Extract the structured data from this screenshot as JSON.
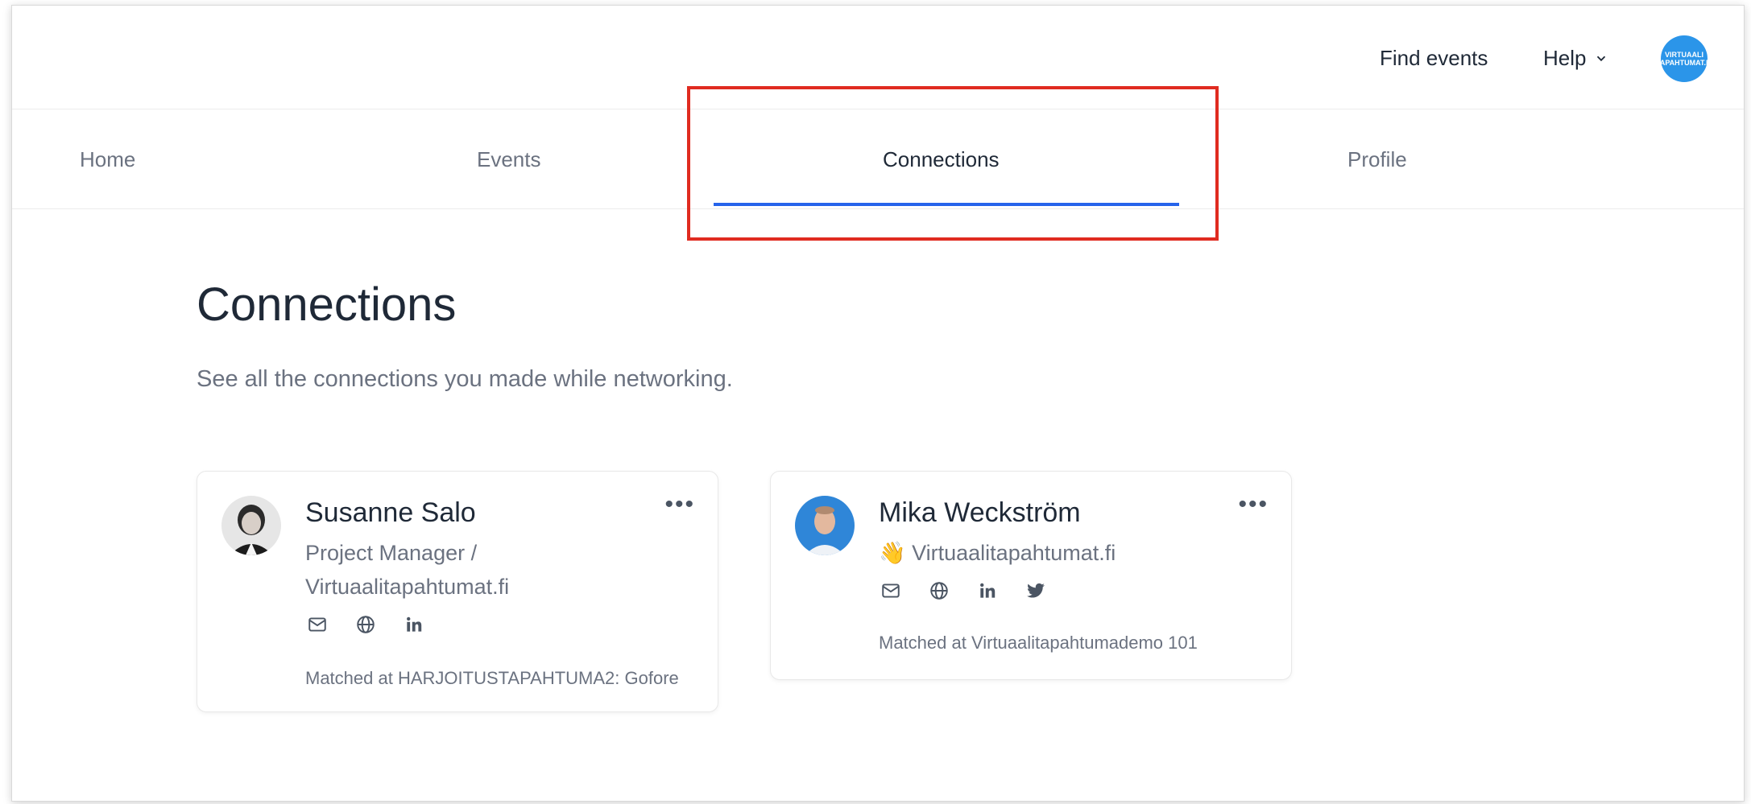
{
  "header": {
    "find_events": "Find events",
    "help": "Help",
    "avatar_text": "VIRTUAALI TAPAHTUMAT.FI"
  },
  "tabs": [
    {
      "label": "Home"
    },
    {
      "label": "Events"
    },
    {
      "label": "Connections",
      "active": true
    },
    {
      "label": "Profile"
    }
  ],
  "main": {
    "title": "Connections",
    "subtitle": "See all the connections you made while networking."
  },
  "connections": [
    {
      "name": "Susanne Salo",
      "title_line1": "Project Manager /",
      "title_line2": "Virtuaalitapahtumat.fi",
      "icons": [
        "mail-icon",
        "globe-icon",
        "linkedin-icon"
      ],
      "matched": "Matched at HARJOITUSTAPAHTUMA2: Gofore",
      "menu": "•••"
    },
    {
      "name": "Mika Weckström",
      "title_line1": "👋 Virtuaalitapahtumat.fi",
      "icons": [
        "mail-icon",
        "globe-icon",
        "linkedin-icon",
        "twitter-icon"
      ],
      "matched": "Matched at Virtuaalitapahtumademo 101",
      "menu": "•••"
    }
  ],
  "colors": {
    "accent": "#2563eb",
    "highlight": "#e02b20",
    "avatar_bg": "#2b95e9"
  }
}
